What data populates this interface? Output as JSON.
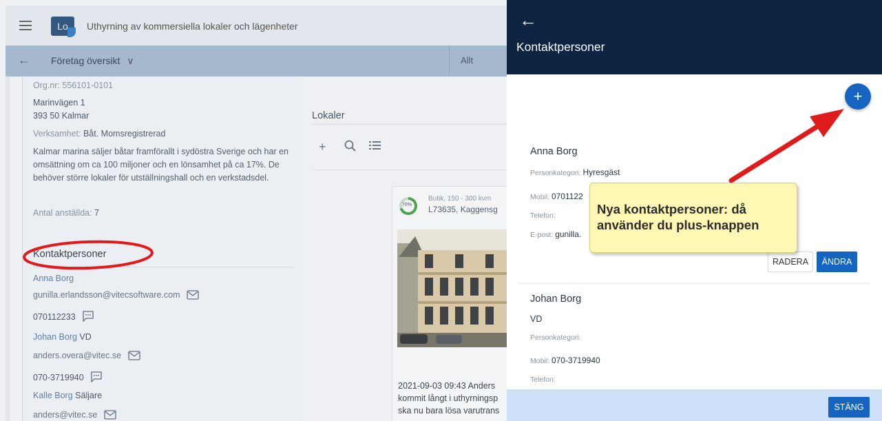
{
  "app": {
    "logo_text": "Lo",
    "title": "Uthyrning av kommersiella lokaler och lägenheter"
  },
  "subbar": {
    "back_icon": "←",
    "title": "Företag översikt",
    "chevron": "∨",
    "filter": "Allt"
  },
  "company": {
    "org_nr": "Org.nr: 556101-0101",
    "street": "Marinvägen 1",
    "postal": "393 50 Kalmar",
    "verksamhet_label": "Verksamhet:",
    "verksamhet_value": "Båt. Momsregistrerad",
    "description": "Kalmar marina säljer båtar framförallt i sydöstra Sverige och har en omsättning om ca 100 miljoner och en lönsamhet på ca 17%. De behöver större lokaler för utställningshall och en verkstadsdel.",
    "employees_label": "Antal anställda:",
    "employees_value": "7"
  },
  "contacts_section": {
    "title": "Kontaktpersoner",
    "c1_name": "Anna Borg",
    "c1_email": "gunilla.erlandsson@vitecsoftware.com",
    "c1_phone": "070112233",
    "c2_name": "Johan Borg",
    "c2_role": "VD",
    "c2_email": "anders.overa@vitec.se",
    "c2_phone": "070-3719940",
    "c3_name": "Kalle Borg",
    "c3_role": "Säljare",
    "c3_email": "anders@vitec.se"
  },
  "lokaler": {
    "title": "Lokaler",
    "add_icon": "+",
    "search_icon": "⌕",
    "list_icon": "≔",
    "pie_label": "70%",
    "progress": 0.7,
    "subtitle": "Butik, 150 - 300 kvm",
    "id": "L73635, Kaggensg",
    "note_line1": "2021-09-03 09:43 Anders",
    "note_line2": "kommit långt i uthyrningsp",
    "note_line3": "ska nu bara lösa varutrans"
  },
  "drawer": {
    "back_icon": "←",
    "title": "Kontaktpersoner",
    "add_icon": "+",
    "p1": {
      "name": "Anna Borg",
      "kategori_label": "Personkategori:",
      "kategori_value": "Hyresgäst",
      "mobil_label": "Mobil:",
      "mobil_value": "0701122",
      "telefon_label": "Telefon:",
      "epost_label": "E-post:",
      "epost_value": "gunilla."
    },
    "radera": "RADERA",
    "andra": "ÄNDRA",
    "p2": {
      "name": "Johan Borg",
      "role": "VD",
      "kategori_label": "Personkategori:",
      "mobil_label": "Mobil:",
      "mobil_value": "070-3719940",
      "telefon_label": "Telefon:"
    },
    "stang": "STÄNG"
  },
  "callout": {
    "line1": "Nya kontaktpersoner: då",
    "line2": "använder du plus-knappen"
  },
  "colors": {
    "drawer_header": "#0d2442",
    "primary_button": "#1565c0",
    "annotation_red": "#e01b1b",
    "callout_bg": "#fff8b5"
  }
}
